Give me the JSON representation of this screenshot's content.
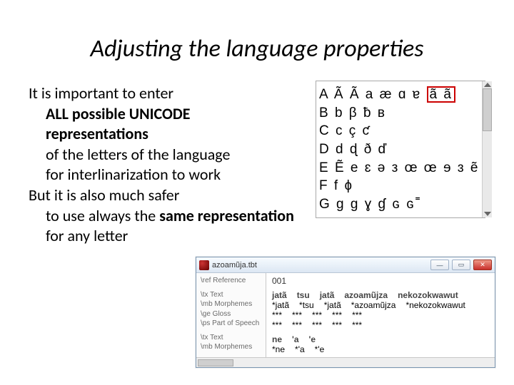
{
  "title": "Adjusting the language properties",
  "body": {
    "p1_a": "It is important to enter",
    "p1_b1": "ALL possible UNICODE",
    "p1_b2": "representations",
    "p1_c": "of the letters of the language",
    "p1_d": "for interlinarization to work",
    "p2_a": "But it is also much safer",
    "p2_b1": "to use always the ",
    "p2_b2": "same representation",
    "p2_b3": " for any letter"
  },
  "char_panel": {
    "rows": {
      "a_pre": "A Ã Ã a æ ɑ ɐ",
      "a_hl": "ã ã",
      "b": "B b β ƀ в",
      "c": "C c ç ƈ",
      "d": "D d ɖ ð ď",
      "e": "E Ẽ e ɛ ə з œ œ ɘ ɜ ẽ",
      "f": "F f ɸ",
      "g": "G g ɡ ɣ ɠ ɢ ɢ˭"
    }
  },
  "app_window": {
    "title": "azoamũja.tbt",
    "buttons": {
      "min": "—",
      "max": "▭",
      "close": "✕"
    },
    "labels": {
      "l0": "\\ref  Reference",
      "l1": "\\tx    Text",
      "l2": "\\mb  Morphemes",
      "l3": "\\ge  Gloss",
      "l4": "\\ps  Part of Speech",
      "l5": "\\tx    Text",
      "l6": "\\mb  Morphemes"
    },
    "values": {
      "ref": "001",
      "tx1": {
        "w0": "jatã",
        "w1": "tsu",
        "w2": "jatã",
        "w3": "azoamũjza",
        "w4": "nekozokwawut"
      },
      "mb1": {
        "w0": "*jatã",
        "w1": "*tsu",
        "w2": "*jatã",
        "w3": "*azoamũjza",
        "w4": "*nekozokwawut"
      },
      "ge": {
        "w0": "***",
        "w1": "***",
        "w2": "***",
        "w3": "***",
        "w4": "***"
      },
      "ps": {
        "w0": "***",
        "w1": "***",
        "w2": "***",
        "w3": "***",
        "w4": "***"
      },
      "tx2": {
        "w0": "ne",
        "w1": "'a",
        "w2": "'e"
      },
      "mb2": {
        "w0": "*ne",
        "w1": "*'a",
        "w2": "*'e"
      }
    }
  }
}
